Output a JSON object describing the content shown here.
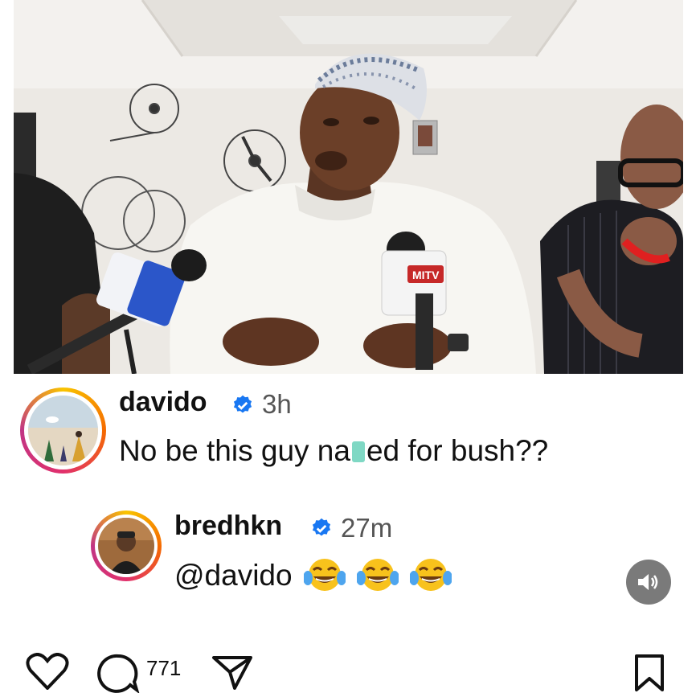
{
  "video": {
    "mic_brand": "MITV"
  },
  "comments": [
    {
      "username": "davido",
      "time": "3h",
      "text_before": "No be this guy na",
      "text_after": "ed for bush??",
      "verified": true
    }
  ],
  "reply": {
    "username": "bredhkn",
    "time": "27m",
    "mention": "@davido",
    "emoji_count": 3,
    "verified": true
  },
  "controls": {
    "audio_icon": "speaker-icon"
  },
  "actions": {
    "comment_count": "771"
  },
  "colors": {
    "verified_blue": "#1877f2",
    "censor_teal": "#7fd8c4",
    "mute_button": "#7a7a7a"
  }
}
